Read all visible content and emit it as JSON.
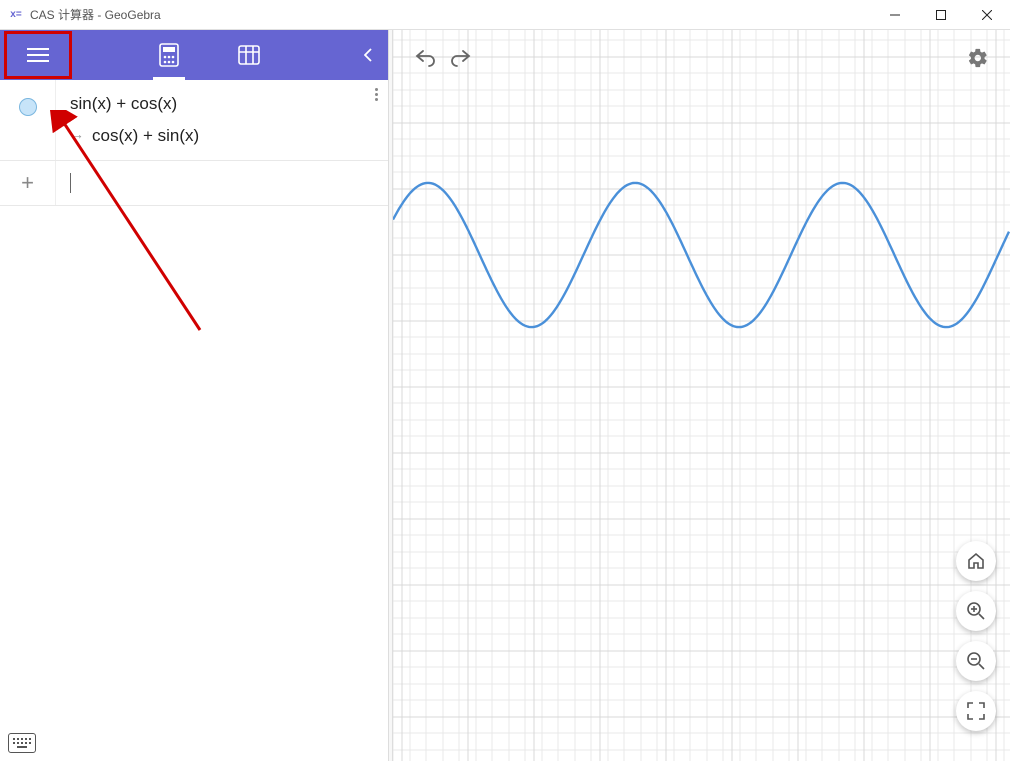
{
  "window": {
    "title": "CAS 计算器 - GeoGebra"
  },
  "toolbar": {
    "menu_name": "main-menu",
    "tab_calc_name": "calculator-tab",
    "tab_table_name": "table-tab",
    "collapse_name": "collapse-panel"
  },
  "cas": {
    "rows": [
      {
        "input": "sin(x) + cos(x)",
        "output": "cos(x) + sin(x)"
      }
    ]
  },
  "graph": {
    "undo_name": "undo",
    "redo_name": "redo",
    "settings_name": "settings",
    "home_name": "home-view",
    "zoom_in_name": "zoom-in",
    "zoom_out_name": "zoom-out",
    "fullscreen_name": "fullscreen"
  },
  "chart_data": {
    "type": "line",
    "title": "",
    "xlabel": "",
    "ylabel": "",
    "function": "sin(x) + cos(x)",
    "x_range_visible": [
      -0.3,
      18.6
    ],
    "y_range_visible": [
      -21.4,
      0.8
    ],
    "amplitude": 1.4142,
    "period": 6.2832,
    "series": [
      {
        "name": "sin(x)+cos(x)",
        "color": "#4a90d9"
      }
    ]
  }
}
